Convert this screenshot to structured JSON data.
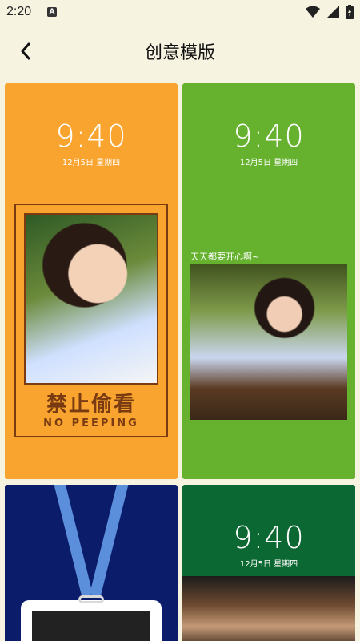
{
  "status": {
    "time": "2:20",
    "app_badge": "A"
  },
  "header": {
    "title": "创意模版"
  },
  "templates": [
    {
      "time": "9:40",
      "date": "12月5日  星期四",
      "banner_cn": "禁止偷看",
      "banner_en": "NO PEEPING",
      "bg": "#f8a42e"
    },
    {
      "time": "9:40",
      "date": "12月5日  星期四",
      "caption": "天天都要开心啊~",
      "bg": "#66b22f"
    },
    {
      "bg": "#0b1c6b"
    },
    {
      "time": "9:40",
      "date": "12月5日  星期四",
      "bg": "#0c6832"
    }
  ],
  "icons": {
    "wifi": "wifi-icon",
    "signal": "signal-icon",
    "battery": "battery-icon",
    "back": "back-arrow-icon"
  }
}
